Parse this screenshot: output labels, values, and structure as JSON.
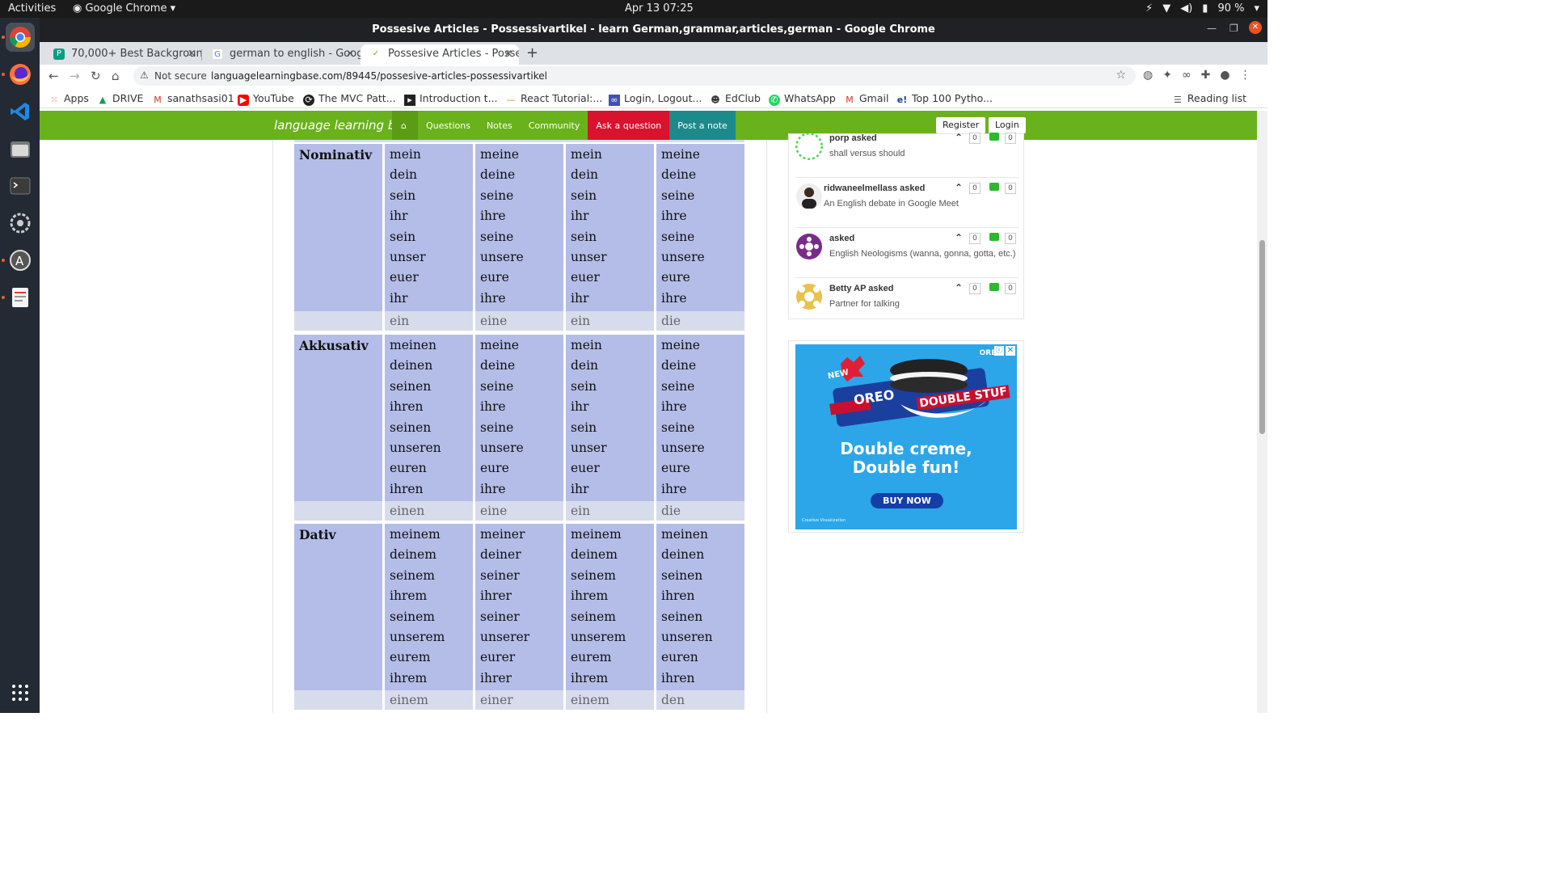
{
  "system": {
    "activities": "Activities",
    "app_name": "Google Chrome",
    "clock": "Apr 13  07:25",
    "battery": "90 %"
  },
  "window": {
    "title": "Possesive Articles - Possessivartikel - learn German,grammar,articles,german - Google Chrome"
  },
  "tabs": [
    {
      "label": "70,000+ Best Background"
    },
    {
      "label": "german to english - Goog"
    },
    {
      "label": "Possesive Articles - Posse"
    }
  ],
  "address": {
    "security": "Not secure",
    "url": "languagelearningbase.com/89445/possesive-articles-possessivartikel"
  },
  "bookmarks": [
    {
      "label": "Apps"
    },
    {
      "label": "DRIVE"
    },
    {
      "label": "sanathsasi01"
    },
    {
      "label": "YouTube"
    },
    {
      "label": "The MVC Patt..."
    },
    {
      "label": "Introduction t..."
    },
    {
      "label": "React Tutorial:..."
    },
    {
      "label": "Login, Logout..."
    },
    {
      "label": "EdClub"
    },
    {
      "label": "WhatsApp"
    },
    {
      "label": "Gmail"
    },
    {
      "label": "Top 100 Pytho..."
    }
  ],
  "reading_list": "Reading list",
  "site": {
    "logo": "language learning base",
    "nav": [
      "Questions",
      "Notes",
      "Community",
      "Ask a question",
      "Post a note"
    ],
    "register": "Register",
    "login": "Login"
  },
  "grammar": {
    "cases": [
      {
        "name": "Nominativ",
        "columns": [
          [
            "mein",
            "dein",
            "sein",
            "ihr",
            "sein",
            "unser",
            "euer",
            "ihr"
          ],
          [
            "meine",
            "deine",
            "seine",
            "ihre",
            "seine",
            "unsere",
            "eure",
            "ihre"
          ],
          [
            "mein",
            "dein",
            "sein",
            "ihr",
            "sein",
            "unser",
            "euer",
            "ihr"
          ],
          [
            "meine",
            "deine",
            "seine",
            "ihre",
            "seine",
            "unsere",
            "eure",
            "ihre"
          ]
        ],
        "articles": [
          "ein",
          "eine",
          "ein",
          "die"
        ]
      },
      {
        "name": "Akkusativ",
        "columns": [
          [
            "meinen",
            "deinen",
            "seinen",
            "ihren",
            "seinen",
            "unseren",
            "euren",
            "ihren"
          ],
          [
            "meine",
            "deine",
            "seine",
            "ihre",
            "seine",
            "unsere",
            "eure",
            "ihre"
          ],
          [
            "mein",
            "dein",
            "sein",
            "ihr",
            "sein",
            "unser",
            "euer",
            "ihr"
          ],
          [
            "meine",
            "deine",
            "seine",
            "ihre",
            "seine",
            "unsere",
            "eure",
            "ihre"
          ]
        ],
        "articles": [
          "einen",
          "eine",
          "ein",
          "die"
        ]
      },
      {
        "name": "Dativ",
        "columns": [
          [
            "meinem",
            "deinem",
            "seinem",
            "ihrem",
            "seinem",
            "unserem",
            "eurem",
            "ihrem"
          ],
          [
            "meiner",
            "deiner",
            "seiner",
            "ihrer",
            "seiner",
            "unserer",
            "eurer",
            "ihrer"
          ],
          [
            "meinem",
            "deinem",
            "seinem",
            "ihrem",
            "seinem",
            "unserem",
            "eurem",
            "ihrem"
          ],
          [
            "meinen",
            "deinen",
            "seinen",
            "ihren",
            "seinen",
            "unseren",
            "euren",
            "ihren"
          ]
        ],
        "articles": [
          "einem",
          "einer",
          "einem",
          "den"
        ]
      }
    ]
  },
  "questions": [
    {
      "asker": "porp asked",
      "text": "shall versus should",
      "votes": "0",
      "answers": "0"
    },
    {
      "asker": "ridwaneelmellass asked",
      "text": "An English debate in Google Meet",
      "votes": "0",
      "answers": "0"
    },
    {
      "asker": "asked",
      "text": "English Neologisms (wanna, gonna, gotta, etc.)",
      "votes": "0",
      "answers": "0"
    },
    {
      "asker": "Betty AP asked",
      "text": "Partner for talking",
      "votes": "0",
      "answers": "0"
    }
  ],
  "ad": {
    "brand": "OREO",
    "product": "DOUBLE STUF",
    "badge": "NEW",
    "headline_1": "Double creme,",
    "headline_2": "Double fun!",
    "cta": "BUY NOW",
    "footer": "Creative Visualization"
  },
  "colors": {
    "site_green": "#69b21b",
    "ask_red": "#d9122d",
    "post_teal": "#1c8a8a",
    "table_blue": "#b4bde8",
    "ad_blue": "#2ca6e8"
  }
}
